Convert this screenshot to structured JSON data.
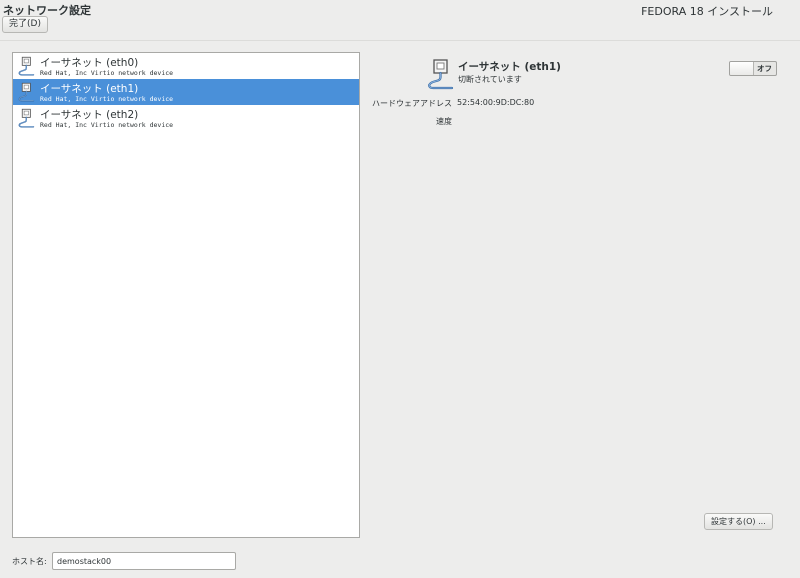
{
  "header": {
    "title": "ネットワーク設定",
    "done_label": "完了(D)",
    "product": "FEDORA 18 インストール"
  },
  "devices": [
    {
      "name": "イーサネット (eth0)",
      "description": "Red Hat, Inc Virtio network device",
      "icon": "network-wired-icon"
    },
    {
      "name": "イーサネット (eth1)",
      "description": "Red Hat, Inc Virtio network device",
      "icon": "network-wired-icon"
    },
    {
      "name": "イーサネット (eth2)",
      "description": "Red Hat, Inc Virtio network device",
      "icon": "network-wired-icon"
    }
  ],
  "selected_device_index": 1,
  "detail": {
    "name": "イーサネット (eth1)",
    "status": "切断されています",
    "hw_address_label": "ハードウェアアドレス",
    "hw_address": "52:54:00:9D:DC:80",
    "speed_label": "速度",
    "toggle_label": "オフ",
    "configure_label": "設定する(O) ..."
  },
  "hostname": {
    "label": "ホスト名:",
    "value": "demostack00"
  },
  "colors": {
    "selection": "#4a90d9",
    "background": "#ededec"
  }
}
